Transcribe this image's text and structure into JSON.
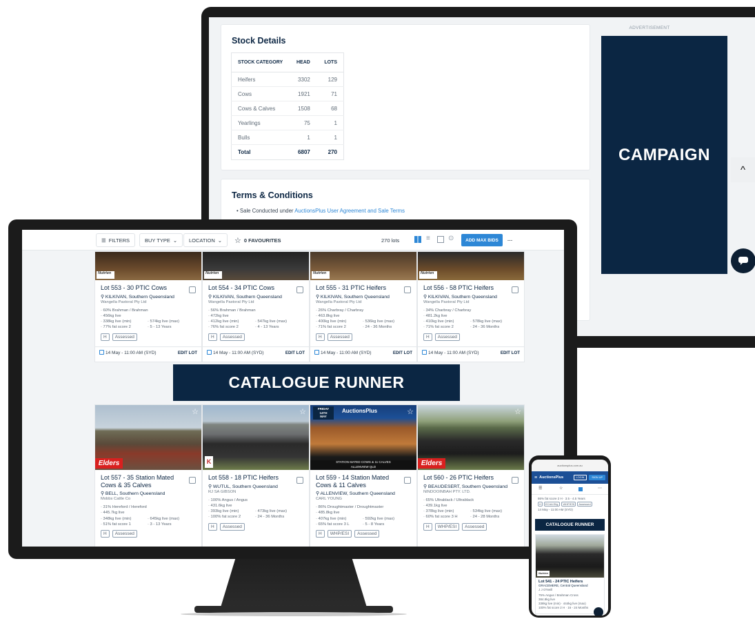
{
  "stock_details": {
    "title": "Stock Details",
    "headers": {
      "category": "STOCK CATEGORY",
      "head": "HEAD",
      "lots": "LOTS"
    },
    "rows": [
      {
        "category": "Heifers",
        "head": "3302",
        "lots": "129"
      },
      {
        "category": "Cows",
        "head": "1921",
        "lots": "71"
      },
      {
        "category": "Cows & Calves",
        "head": "1508",
        "lots": "68"
      },
      {
        "category": "Yearlings",
        "head": "75",
        "lots": "1"
      },
      {
        "category": "Bulls",
        "head": "1",
        "lots": "1"
      }
    ],
    "total": {
      "label": "Total",
      "head": "6807",
      "lots": "270"
    }
  },
  "terms": {
    "title": "Terms & Conditions",
    "item_prefix": "Sale Conducted under ",
    "item_link": "AuctionsPlus User Agreement and Sale Terms"
  },
  "advertisement": {
    "label": "ADVERTISEMENT",
    "campaign": "CAMPAIGN"
  },
  "colors": {
    "navy": "#0b2643",
    "accent": "#2d87d6",
    "elders_red": "#d9201f"
  },
  "toolbar": {
    "filters": "FILTERS",
    "buy_type": "BUY TYPE",
    "location": "LOCATION",
    "favourites": "0 FAVOURITES",
    "lot_count": "270",
    "lot_unit": "lots",
    "add_max_bids": "ADD MAX BIDS",
    "more": "···"
  },
  "catalogue_runner": "CATALOGUE RUNNER",
  "logos": {
    "nutrien": "Nutrien",
    "elders": "Elders"
  },
  "cards_top": [
    {
      "title": "Lot 553 - 30 PTIC Cows",
      "location": "KILKIVAN, Southern Queensland",
      "vendor": "Wangella Pastoral Pty Ltd",
      "breed": "60% Brahman / Brahman",
      "weight": "456kg live",
      "min": "338kg live (min)",
      "max": "574kg live (max)",
      "fat": "77% fat score 2",
      "age": "5 - 13 Years",
      "tags": [
        "H",
        "Assessed"
      ],
      "date": "14 May - 11:00 AM (SYD)",
      "edit": "EDIT LOT"
    },
    {
      "title": "Lot 554 - 34 PTIC Cows",
      "location": "KILKIVAN, Southern Queensland",
      "vendor": "Wangella Pastoral Pty Ltd",
      "breed": "56% Brahman / Brahman",
      "weight": "472kg live",
      "min": "412kg live (min)",
      "max": "547kg live (max)",
      "fat": "76% fat score 2",
      "age": "4 - 13 Years",
      "tags": [
        "H",
        "Assessed"
      ],
      "date": "14 May - 11:00 AM (SYD)",
      "edit": "EDIT LOT"
    },
    {
      "title": "Lot 555 - 31 PTIC Heifers",
      "location": "KILKIVAN, Southern Queensland",
      "vendor": "Wangella Pastoral Pty Ltd",
      "breed": "26% Charbray / Charbray",
      "weight": "463.8kg live",
      "min": "400kg live (min)",
      "max": "536kg live (max)",
      "fat": "71% fat score 2",
      "age": "24 - 36 Months",
      "tags": [
        "H",
        "Assessed"
      ],
      "date": "14 May - 11:00 AM (SYD)",
      "edit": "EDIT LOT"
    },
    {
      "title": "Lot 556 - 58 PTIC Heifers",
      "location": "KILKIVAN, Southern Queensland",
      "vendor": "Wangella Pastoral Pty Ltd",
      "breed": "34% Charbray / Charbray",
      "weight": "481.2kg live",
      "min": "410kg live (min)",
      "max": "578kg live (max)",
      "fat": "71% fat score 2",
      "age": "24 - 36 Months",
      "tags": [
        "H",
        "Assessed"
      ],
      "date": "14 May - 11:00 AM (SYD)",
      "edit": "EDIT LOT"
    }
  ],
  "cards_bottom": [
    {
      "title": "Lot 557 - 35 Station Mated Cows & 35 Calves",
      "location": "BELL, Southern Queensland",
      "vendor": "Mobbs Cattle Co",
      "breed": "31% Hereford / Hereford",
      "weight": "445.7kg live",
      "min": "348kg live (min)",
      "max": "645kg live (max)",
      "fat": "51% fat score 1",
      "age": "3 - 13 Years",
      "tags": [
        "H",
        "Assessed"
      ]
    },
    {
      "title": "Lot 558 - 18 PTIC Heifers",
      "location": "WUTUL, Southern Queensland",
      "vendor": "RJ SA GIBSON",
      "breed": "100% Angus / Angus",
      "weight": "431.6kg live",
      "min": "393kg live (min)",
      "max": "473kg live (max)",
      "fat": "100% fat score 2",
      "age": "24 - 36 Months",
      "tags": [
        "H",
        "Assessed"
      ]
    },
    {
      "title": "Lot 559 - 14 Station Mated Cows & 11 Calves",
      "location": "ALLENVIEW, Southern Queensland",
      "vendor": "CARL YOUNG",
      "breed": "86% Droughtmaster / Droughtmaster",
      "weight": "485.8kg live",
      "min": "407kg live (min)",
      "max": "592kg live (max)",
      "fat": "65% fat score 3 L",
      "age": "5 - 8 Years",
      "tags": [
        "H",
        "WHP/ESI",
        "Assessed"
      ]
    },
    {
      "title": "Lot 560 - 26 PTIC Heifers",
      "location": "BEAUDESERT, Southern Queensland",
      "vendor": "NINDOOINBAH PTY. LTD.",
      "breed": "65% Ultrablack / Ultrablack",
      "weight": "439.1kg live",
      "min": "378kg live (min)",
      "max": "534kg live (max)",
      "fat": "60% fat score 3 H",
      "age": "24 - 28 Months",
      "tags": [
        "H",
        "WHP/ESI",
        "Assessed"
      ]
    }
  ],
  "promo_image": {
    "brand": "AuctionsPlus",
    "line1": "FRIDAY",
    "line2": "14TH",
    "line3": "MAY",
    "banner": "STATION MATED COWS & 11 CALVES",
    "place": "ALLENVIEW QLD"
  },
  "phone": {
    "url": "auctionsplus.com.au",
    "brand": "AuctionsPlus",
    "login": "LOGIN",
    "signup": "SIGN UP",
    "snippet_fat": "86% fat score 2 H",
    "snippet_age": "3.5 - 4.5 Years",
    "snippet_tags": [
      "H",
      "ECAA Elig.",
      "WHP/ESI",
      "Assessed"
    ],
    "snippet_date": "14 May - 11:00 AM (SYD)",
    "runner": "CATALOGUE RUNNER",
    "lot_title": "Lot 541 - 24 PTIC Heifers",
    "lot_location": "GRACEMERE, Central Queensland",
    "lot_vendor": "J J O'Neill",
    "lot_breed": "75% Angus / Brahman Cross",
    "lot_weight": "384.8kg live",
    "lot_min": "338kg live (min)",
    "lot_max": "444kg live (max)",
    "lot_fat": "100% fat score 2 H",
    "lot_age": "16 - 24 Months"
  }
}
